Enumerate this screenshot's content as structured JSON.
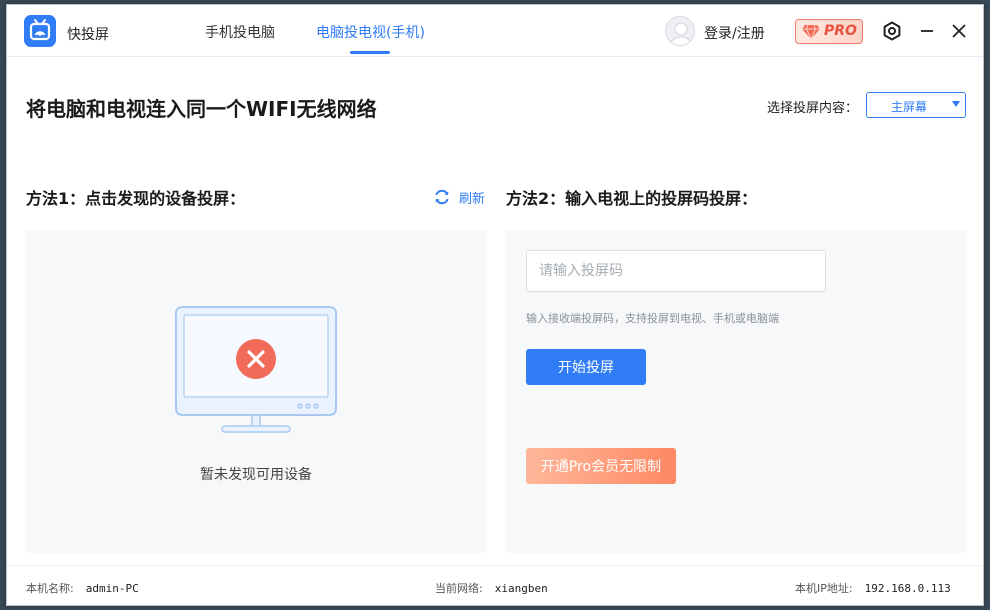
{
  "app": {
    "name": "快投屏",
    "brand_color": "#2f7cf6",
    "pro_color": "#e8533f"
  },
  "tabs": [
    {
      "label": "手机投电脑",
      "active": false
    },
    {
      "label": "电脑投电视(手机)",
      "active": true
    }
  ],
  "header": {
    "login_label": "登录/注册",
    "pro_label": "PRO",
    "icons": [
      "settings-icon",
      "minimize-icon",
      "close-icon"
    ]
  },
  "main": {
    "headline": "将电脑和电视连入同一个WIFI无线网络",
    "select_label": "选择投屏内容：",
    "select_value": "主屏幕"
  },
  "method1": {
    "title": "方法1：点击发现的设备投屏：",
    "refresh_label": "刷新",
    "empty_text": "暂未发现可用设备"
  },
  "method2": {
    "title": "方法2：输入电视上的投屏码投屏：",
    "input_placeholder": "请输入投屏码",
    "input_value": "",
    "hint": "输入接收端投屏码，支持投屏到电视、手机或电脑端",
    "start_label": "开始投屏",
    "pro_label": "开通Pro会员无限制"
  },
  "footer": {
    "host_label": "本机名称:",
    "host_value": "admin-PC",
    "net_label": "当前网络:",
    "net_value": "xiangben",
    "ip_label": "本机IP地址:",
    "ip_value": "192.168.0.113"
  }
}
